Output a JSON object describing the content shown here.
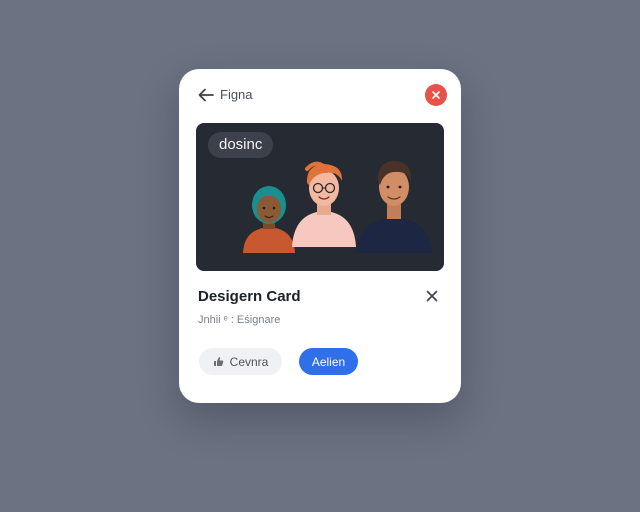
{
  "colors": {
    "backdrop": "#6b7282",
    "card": "#ffffff",
    "close_button": "#e8524a",
    "primary_button": "#2f6fea",
    "hero_background": "#262a33"
  },
  "header": {
    "back_icon": "arrow-left-icon",
    "title": "Figna",
    "close_icon": "close-icon"
  },
  "hero": {
    "chip_label": "dosinc",
    "illustration": "three-people-avatars"
  },
  "card": {
    "title": "Desigern Card",
    "subtitle": "Jnhii ᵉ : Eśignare",
    "dismiss_icon": "close-icon"
  },
  "actions": {
    "secondary_label": "Cevnra",
    "secondary_icon": "thumbs-up-icon",
    "primary_label": "Aelien"
  }
}
